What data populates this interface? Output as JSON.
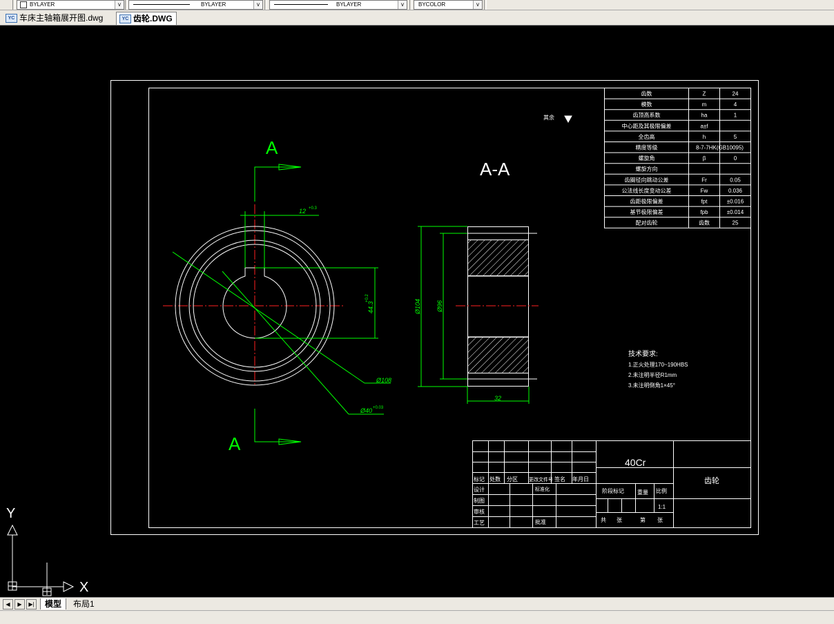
{
  "toolbar": {
    "color_combo": "BYLAYER",
    "linetype_combo": "BYLAYER",
    "lineweight_combo": "BYLAYER",
    "plotstyle_combo": "BYCOLOR"
  },
  "file_tabs": [
    {
      "label": "车床主轴箱展开图.dwg",
      "icon": "dwg-file-icon",
      "active": false
    },
    {
      "label": "齿轮.DWG",
      "icon": "dwg-file-icon",
      "active": true
    }
  ],
  "layout_tabs": [
    {
      "label": "模型",
      "active": true
    },
    {
      "label": "布局1",
      "active": false
    }
  ],
  "nav_buttons": [
    "◀",
    "▶",
    "▶|"
  ],
  "drawing": {
    "section_mark_top": "A",
    "section_mark_bottom": "A",
    "section_title": "A-A",
    "remainder_label": "其余",
    "dims": {
      "keyway_width": "12",
      "keyway_width_tol": "+0.3",
      "keyway_depth": "44.3",
      "keyway_depth_tol": "+0.2",
      "outer_dia": "Ø108",
      "bore_dia": "Ø40",
      "bore_tol": "+0.03",
      "side_outer_dia": "Ø104",
      "side_hub_dia": "Ø96",
      "face_width": "32"
    },
    "tech_requirements": {
      "title": "技术要求:",
      "items": [
        "1.正火处理170~190HBS",
        "2.未注明半径R1mm",
        "3.未注明倒角1×45°"
      ]
    },
    "param_table": [
      {
        "name": "齿数",
        "symbol": "Z",
        "value": "24"
      },
      {
        "name": "模数",
        "symbol": "m",
        "value": "4"
      },
      {
        "name": "齿顶高系数",
        "symbol": "ha",
        "value": "1"
      },
      {
        "name": "中心距及其极限偏差",
        "symbol": "a±f",
        "value": ""
      },
      {
        "name": "全齿高",
        "symbol": "h",
        "value": "5"
      },
      {
        "name": "精度等级",
        "symbol": "8-7-7HK(GB10095)",
        "value": ""
      },
      {
        "name": "螺旋角",
        "symbol": "β",
        "value": "0"
      },
      {
        "name": "螺旋方向",
        "symbol": "",
        "value": ""
      },
      {
        "name": "齿圈径向跳动公差",
        "symbol": "Fr",
        "value": "0.05"
      },
      {
        "name": "公法线长度变动公差",
        "symbol": "Fw",
        "value": "0.036"
      },
      {
        "name": "齿距极限偏差",
        "symbol": "fpt",
        "value": "±0.016"
      },
      {
        "name": "基节极限偏差",
        "symbol": "fpb",
        "value": "±0.014"
      },
      {
        "name": "配对齿轮",
        "symbol": "齿数",
        "value": "25"
      }
    ],
    "title_block": {
      "material": "40Cr",
      "part_name": "齿轮",
      "headers": [
        "标记",
        "处数",
        "分区",
        "更改文件号",
        "签名",
        "年月日"
      ],
      "rows_left": [
        "设计",
        "制图",
        "审核",
        "工艺"
      ],
      "standardize": "标准化",
      "approve": "批准",
      "stage_mark": "阶段标记",
      "weight": "重量",
      "scale_label": "比例",
      "scale_value": "1:1",
      "sheets_total": "共",
      "sheets_unit": "张",
      "sheet_no": "第",
      "sheet_unit2": "张"
    },
    "ucs": {
      "x_label": "X",
      "y_label": "Y"
    }
  },
  "colors": {
    "background": "#000000",
    "line": "#ffffff",
    "dimension": "#00ff00",
    "centerline": "#ff0000",
    "hatch": "#ffffff"
  }
}
